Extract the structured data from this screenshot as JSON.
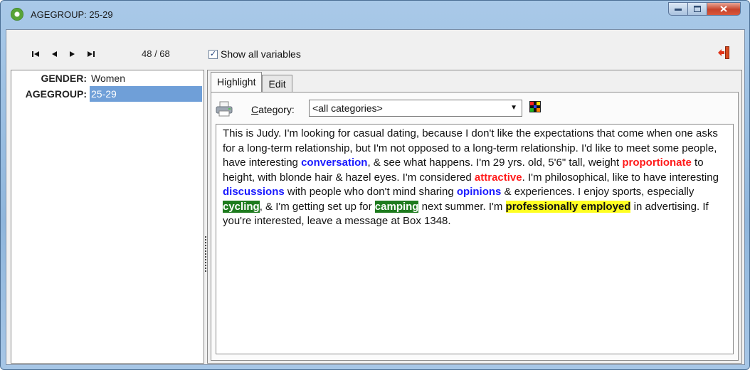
{
  "window": {
    "title": "AGEGROUP: 25-29"
  },
  "toolbar": {
    "counter": "48 / 68",
    "show_all_label": "Show all variables",
    "show_all_checked": true
  },
  "variables": [
    {
      "name": "GENDER:",
      "value": "Women",
      "selected": false
    },
    {
      "name": "AGEGROUP:",
      "value": "25-29",
      "selected": true
    }
  ],
  "tabs": [
    {
      "label": "Highlight",
      "active": true
    },
    {
      "label": "Edit",
      "active": false
    }
  ],
  "category": {
    "label_prefix": "C",
    "label_rest": "ategory:",
    "selected": "<all categories>"
  },
  "colors": {
    "blue": "#1a1aff",
    "red": "#ff1a1a",
    "green": "#1e7b1e",
    "yellow": "#ffff22",
    "selection": "#6f9fd8"
  },
  "document": {
    "segments": [
      {
        "text": "This is Judy. I'm looking for casual dating, because I don't like the expectations that come when one asks for a long-term relationship, but I'm not opposed to a long-term relationship. I'd like to meet some people, have interesting ",
        "style": "plain"
      },
      {
        "text": "conversation",
        "style": "blue"
      },
      {
        "text": ", & see what happens. I'm 29 yrs. old, 5'6\" tall, weight ",
        "style": "plain"
      },
      {
        "text": "proportionate",
        "style": "red"
      },
      {
        "text": " to height, with blonde hair & hazel eyes. I'm considered ",
        "style": "plain"
      },
      {
        "text": "attractive",
        "style": "red"
      },
      {
        "text": ". I'm philosophical, like to have interesting ",
        "style": "plain"
      },
      {
        "text": "discussions",
        "style": "blue"
      },
      {
        "text": " with people who don't mind sharing ",
        "style": "plain"
      },
      {
        "text": "opinions",
        "style": "blue"
      },
      {
        "text": " & experiences. I enjoy sports, especially ",
        "style": "plain"
      },
      {
        "text": "cycling",
        "style": "green"
      },
      {
        "text": ", & I'm getting set up for ",
        "style": "plain"
      },
      {
        "text": "camping",
        "style": "green"
      },
      {
        "text": " next summer. I'm ",
        "style": "plain"
      },
      {
        "text": "professionally employed",
        "style": "yellow"
      },
      {
        "text": " in advertising. If you're interested, leave a message at Box 1348.",
        "style": "plain"
      }
    ]
  },
  "icons": [
    "app-icon",
    "first-record-icon",
    "previous-record-icon",
    "next-record-icon",
    "last-record-icon",
    "exit-icon",
    "printer-icon",
    "color-grid-icon",
    "dropdown-arrow-icon"
  ]
}
